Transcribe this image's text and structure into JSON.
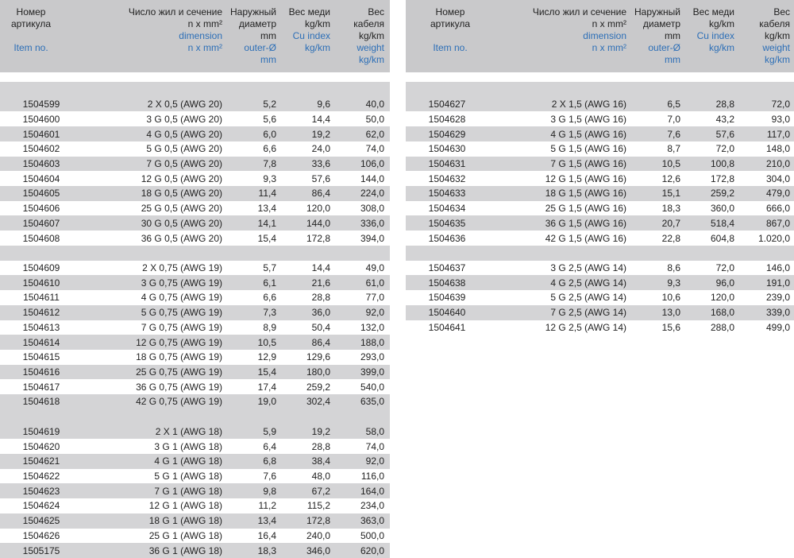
{
  "header": {
    "col0": {
      "ru": [
        "Номер",
        "артикула"
      ],
      "en": [
        "Item no."
      ]
    },
    "col1": {
      "ru": [
        "Число жил и сечение",
        "n x mm²"
      ],
      "en": [
        "dimension",
        "n x mm²"
      ]
    },
    "col2": {
      "ru": [
        "Наружный",
        "диаметр",
        "mm"
      ],
      "en": [
        "outer-Ø",
        "mm"
      ]
    },
    "col3": {
      "ru": [
        "Вес меди",
        "kg/km"
      ],
      "en": [
        "Cu index",
        "kg/km"
      ]
    },
    "col4": {
      "ru": [
        "Вес",
        "кабеля",
        "kg/km"
      ],
      "en": [
        "weight",
        "kg/km"
      ]
    }
  },
  "left_rows": [
    [
      "",
      "",
      "",
      "",
      ""
    ],
    [
      "1504599",
      "2 X 0,5 (AWG 20)",
      "5,2",
      "9,6",
      "40,0"
    ],
    [
      "1504600",
      "3 G 0,5 (AWG 20)",
      "5,6",
      "14,4",
      "50,0"
    ],
    [
      "1504601",
      "4 G 0,5 (AWG 20)",
      "6,0",
      "19,2",
      "62,0"
    ],
    [
      "1504602",
      "5 G 0,5 (AWG 20)",
      "6,6",
      "24,0",
      "74,0"
    ],
    [
      "1504603",
      "7 G 0,5 (AWG 20)",
      "7,8",
      "33,6",
      "106,0"
    ],
    [
      "1504604",
      "12 G 0,5 (AWG 20)",
      "9,3",
      "57,6",
      "144,0"
    ],
    [
      "1504605",
      "18 G 0,5 (AWG 20)",
      "11,4",
      "86,4",
      "224,0"
    ],
    [
      "1504606",
      "25 G 0,5 (AWG 20)",
      "13,4",
      "120,0",
      "308,0"
    ],
    [
      "1504607",
      "30 G 0,5 (AWG 20)",
      "14,1",
      "144,0",
      "336,0"
    ],
    [
      "1504608",
      "36 G 0,5 (AWG 20)",
      "15,4",
      "172,8",
      "394,0"
    ],
    [
      "",
      "",
      "",
      "",
      ""
    ],
    [
      "1504609",
      "2 X 0,75 (AWG 19)",
      "5,7",
      "14,4",
      "49,0"
    ],
    [
      "1504610",
      "3 G 0,75 (AWG 19)",
      "6,1",
      "21,6",
      "61,0"
    ],
    [
      "1504611",
      "4 G 0,75 (AWG 19)",
      "6,6",
      "28,8",
      "77,0"
    ],
    [
      "1504612",
      "5 G 0,75 (AWG 19)",
      "7,3",
      "36,0",
      "92,0"
    ],
    [
      "1504613",
      "7 G 0,75 (AWG 19)",
      "8,9",
      "50,4",
      "132,0"
    ],
    [
      "1504614",
      "12 G 0,75 (AWG 19)",
      "10,5",
      "86,4",
      "188,0"
    ],
    [
      "1504615",
      "18 G 0,75 (AWG 19)",
      "12,9",
      "129,6",
      "293,0"
    ],
    [
      "1504616",
      "25 G 0,75 (AWG 19)",
      "15,4",
      "180,0",
      "399,0"
    ],
    [
      "1504617",
      "36 G 0,75 (AWG 19)",
      "17,4",
      "259,2",
      "540,0"
    ],
    [
      "1504618",
      "42 G 0,75 (AWG 19)",
      "19,0",
      "302,4",
      "635,0"
    ],
    [
      "",
      "",
      "",
      "",
      ""
    ],
    [
      "1504619",
      "2 X 1 (AWG 18)",
      "5,9",
      "19,2",
      "58,0"
    ],
    [
      "1504620",
      "3 G 1 (AWG 18)",
      "6,4",
      "28,8",
      "74,0"
    ],
    [
      "1504621",
      "4 G 1 (AWG 18)",
      "6,8",
      "38,4",
      "92,0"
    ],
    [
      "1504622",
      "5 G 1 (AWG 18)",
      "7,6",
      "48,0",
      "116,0"
    ],
    [
      "1504623",
      "7 G 1 (AWG 18)",
      "9,8",
      "67,2",
      "164,0"
    ],
    [
      "1504624",
      "12 G 1 (AWG 18)",
      "11,2",
      "115,2",
      "234,0"
    ],
    [
      "1504625",
      "18 G 1 (AWG 18)",
      "13,4",
      "172,8",
      "363,0"
    ],
    [
      "1504626",
      "25 G 1 (AWG 18)",
      "16,4",
      "240,0",
      "500,0"
    ],
    [
      "1505175",
      "36 G 1 (AWG 18)",
      "18,3",
      "346,0",
      "620,0"
    ]
  ],
  "right_rows": [
    [
      "",
      "",
      "",
      "",
      ""
    ],
    [
      "1504627",
      "2 X 1,5 (AWG 16)",
      "6,5",
      "28,8",
      "72,0"
    ],
    [
      "1504628",
      "3 G 1,5 (AWG 16)",
      "7,0",
      "43,2",
      "93,0"
    ],
    [
      "1504629",
      "4 G 1,5 (AWG 16)",
      "7,6",
      "57,6",
      "117,0"
    ],
    [
      "1504630",
      "5 G 1,5 (AWG 16)",
      "8,7",
      "72,0",
      "148,0"
    ],
    [
      "1504631",
      "7 G 1,5 (AWG 16)",
      "10,5",
      "100,8",
      "210,0"
    ],
    [
      "1504632",
      "12 G 1,5 (AWG 16)",
      "12,6",
      "172,8",
      "304,0"
    ],
    [
      "1504633",
      "18 G 1,5 (AWG 16)",
      "15,1",
      "259,2",
      "479,0"
    ],
    [
      "1504634",
      "25 G 1,5 (AWG 16)",
      "18,3",
      "360,0",
      "666,0"
    ],
    [
      "1504635",
      "36 G 1,5 (AWG 16)",
      "20,7",
      "518,4",
      "867,0"
    ],
    [
      "1504636",
      "42 G 1,5 (AWG 16)",
      "22,8",
      "604,8",
      "1.020,0"
    ],
    [
      "",
      "",
      "",
      "",
      ""
    ],
    [
      "1504637",
      "3 G 2,5 (AWG 14)",
      "8,6",
      "72,0",
      "146,0"
    ],
    [
      "1504638",
      "4 G 2,5 (AWG 14)",
      "9,3",
      "96,0",
      "191,0"
    ],
    [
      "1504639",
      "5 G 2,5 (AWG 14)",
      "10,6",
      "120,0",
      "239,0"
    ],
    [
      "1504640",
      "7 G 2,5 (AWG 14)",
      "13,0",
      "168,0",
      "339,0"
    ],
    [
      "1504641",
      "12 G 2,5 (AWG 14)",
      "15,6",
      "288,0",
      "499,0"
    ]
  ],
  "colors": {
    "header_bg": "#c9c9cb",
    "shade": "#d4d4d6",
    "english_text": "#2d6fb7"
  }
}
